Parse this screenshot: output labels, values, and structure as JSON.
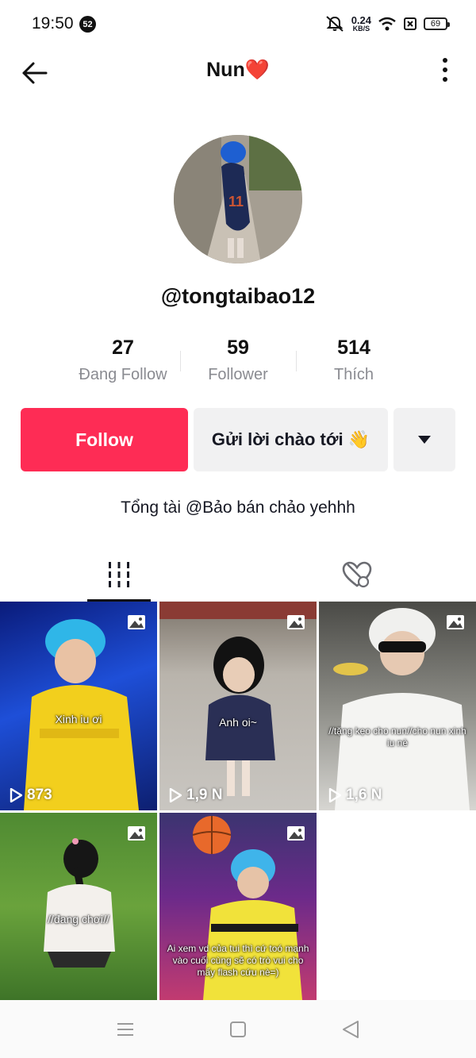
{
  "status_bar": {
    "time": "19:50",
    "notification_count": "52",
    "net_speed": "0.24",
    "net_speed_unit": "KB/S",
    "battery": "69"
  },
  "header": {
    "title": "Nun❤️"
  },
  "profile": {
    "username": "@tongtaibao12",
    "stats": [
      {
        "value": "27",
        "label": "Đang Follow"
      },
      {
        "value": "59",
        "label": "Follower"
      },
      {
        "value": "514",
        "label": "Thích"
      }
    ],
    "follow_label": "Follow",
    "greet_label": "Gửi lời chào tới 👋",
    "bio": "Tổng tài @Bảo bán chảo yehhh"
  },
  "tabs": [
    "videos-grid-icon",
    "liked-hidden-icon"
  ],
  "videos": [
    {
      "caption": "Xinh iu ơi",
      "views": "873"
    },
    {
      "caption": "Anh oi~",
      "views": "1,9 N"
    },
    {
      "caption": "//tặng kẹo cho nun//cho nun xinh iu nè",
      "views": "1,6 N"
    },
    {
      "caption": "//đang chơi//",
      "views": ""
    },
    {
      "caption": "Ai xem vd của tui thì cứ toó mạnh vào cuối cùng sẽ có trò vui cho mấy flash cứu nè=)",
      "views": ""
    }
  ],
  "colors": {
    "accent": "#fe2c55",
    "secondary_bg": "#f1f1f2",
    "text_primary": "#161823",
    "text_secondary": "#8a8b91"
  }
}
